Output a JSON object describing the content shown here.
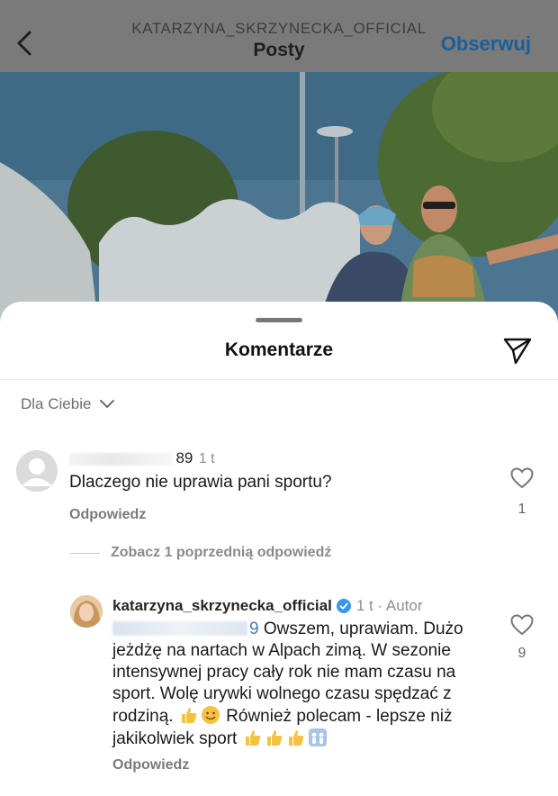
{
  "header": {
    "username": "KATARZYNA_SKRZYNECKA_OFFICIAL",
    "title": "Posty",
    "follow_label": "Obserwuj",
    "icons": {
      "back": "chevron-left-icon"
    }
  },
  "sheet": {
    "title": "Komentarze",
    "sort_label": "Dla Ciebie",
    "icons": {
      "share": "paper-plane-icon",
      "sort": "chevron-down-icon"
    }
  },
  "comments": [
    {
      "username_suffix": "89",
      "time": "1 t",
      "text": "Dlaczego nie uprawia pani sportu?",
      "reply_label": "Odpowiedz",
      "likes": "1"
    },
    {
      "view_previous_label": "Zobacz 1 poprzednią odpowiedź",
      "username": "katarzyna_skrzynecka_official",
      "time": "1 t · Autor",
      "mention_suffix": "9",
      "text_part1": "Owszem, uprawiam. Dużo jeżdżę na nartach w Alpach zimą. W sezonie intensywnej pracy cały rok nie mam czasu na sport. Wolę urywki wolnego czasu spędzać z rodziną.",
      "text_part2": "Również polecam - lepsze niż jakikolwiek sport",
      "reply_label": "Odpowiedz",
      "likes": "9"
    }
  ],
  "colors": {
    "accent": "#1a5f99",
    "muted": "#8e8e8e",
    "verified": "#3897f0"
  }
}
